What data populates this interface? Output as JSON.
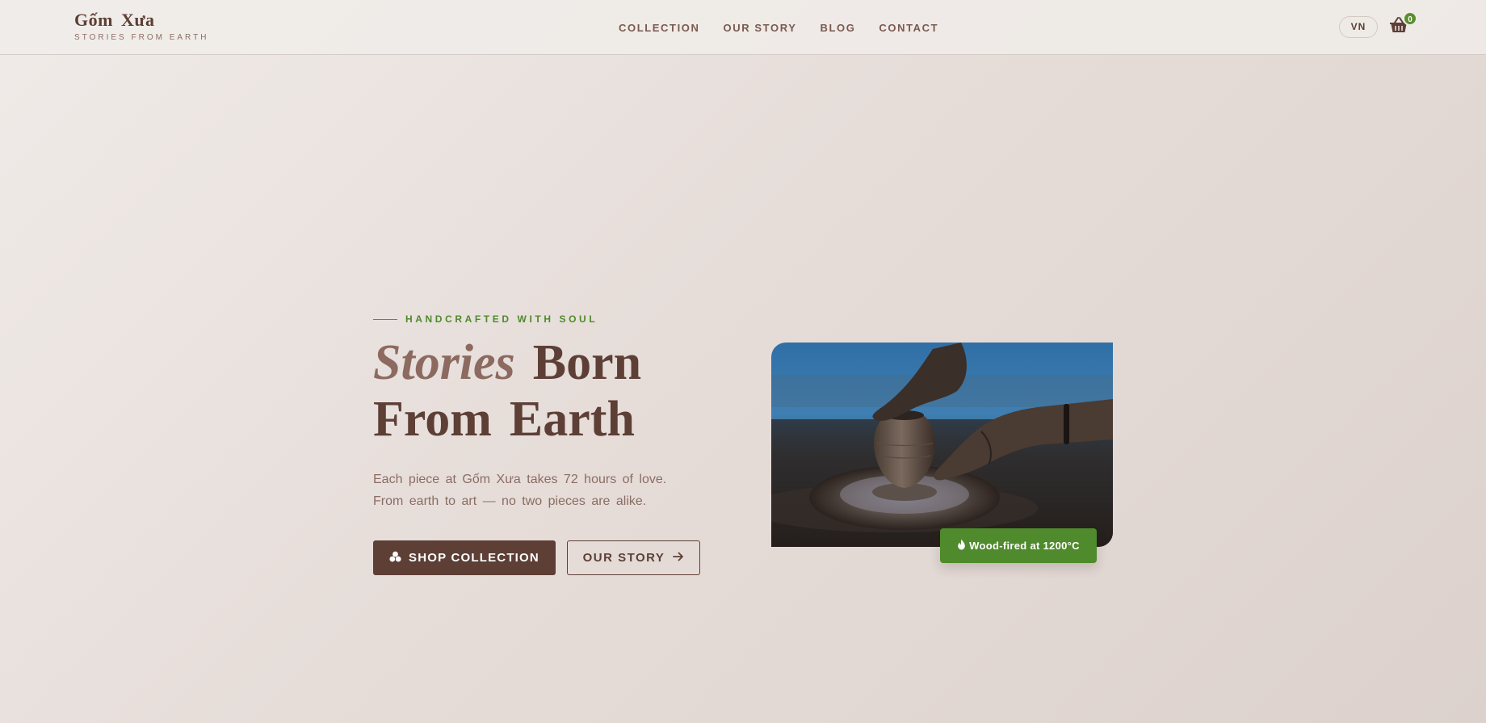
{
  "brand": {
    "name": "Gốm Xưa",
    "tagline": "STORIES FROM EARTH"
  },
  "nav": {
    "items": [
      {
        "label": "COLLECTION"
      },
      {
        "label": "OUR STORY"
      },
      {
        "label": "BLOG"
      },
      {
        "label": "CONTACT"
      }
    ]
  },
  "header": {
    "lang_label": "VN",
    "cart_count": "0",
    "cart_icon": "basket-icon"
  },
  "hero": {
    "eyebrow": "HANDCRAFTED WITH SOUL",
    "headline": {
      "accent": "Stories",
      "word2": "Born",
      "word3": "From",
      "word4": "Earth"
    },
    "lede": "Each piece at Gốm Xưa takes 72 hours of love. From earth to art — no two pieces are alike.",
    "primary_cta": {
      "label": "SHOP COLLECTION",
      "icon": "vase-cluster-icon"
    },
    "secondary_cta": {
      "label": "OUR STORY",
      "icon": "arrow-right-icon"
    },
    "image_alt": "Hands shaping a clay pot on a pottery wheel",
    "badge": {
      "label": "Wood-fired at 1200°C",
      "icon": "flame-icon"
    }
  },
  "colors": {
    "brand_brown": "#5d3f36",
    "muted_brown": "#8c6a60",
    "accent_green": "#4f8a2c",
    "background": "#e6ddd9"
  }
}
